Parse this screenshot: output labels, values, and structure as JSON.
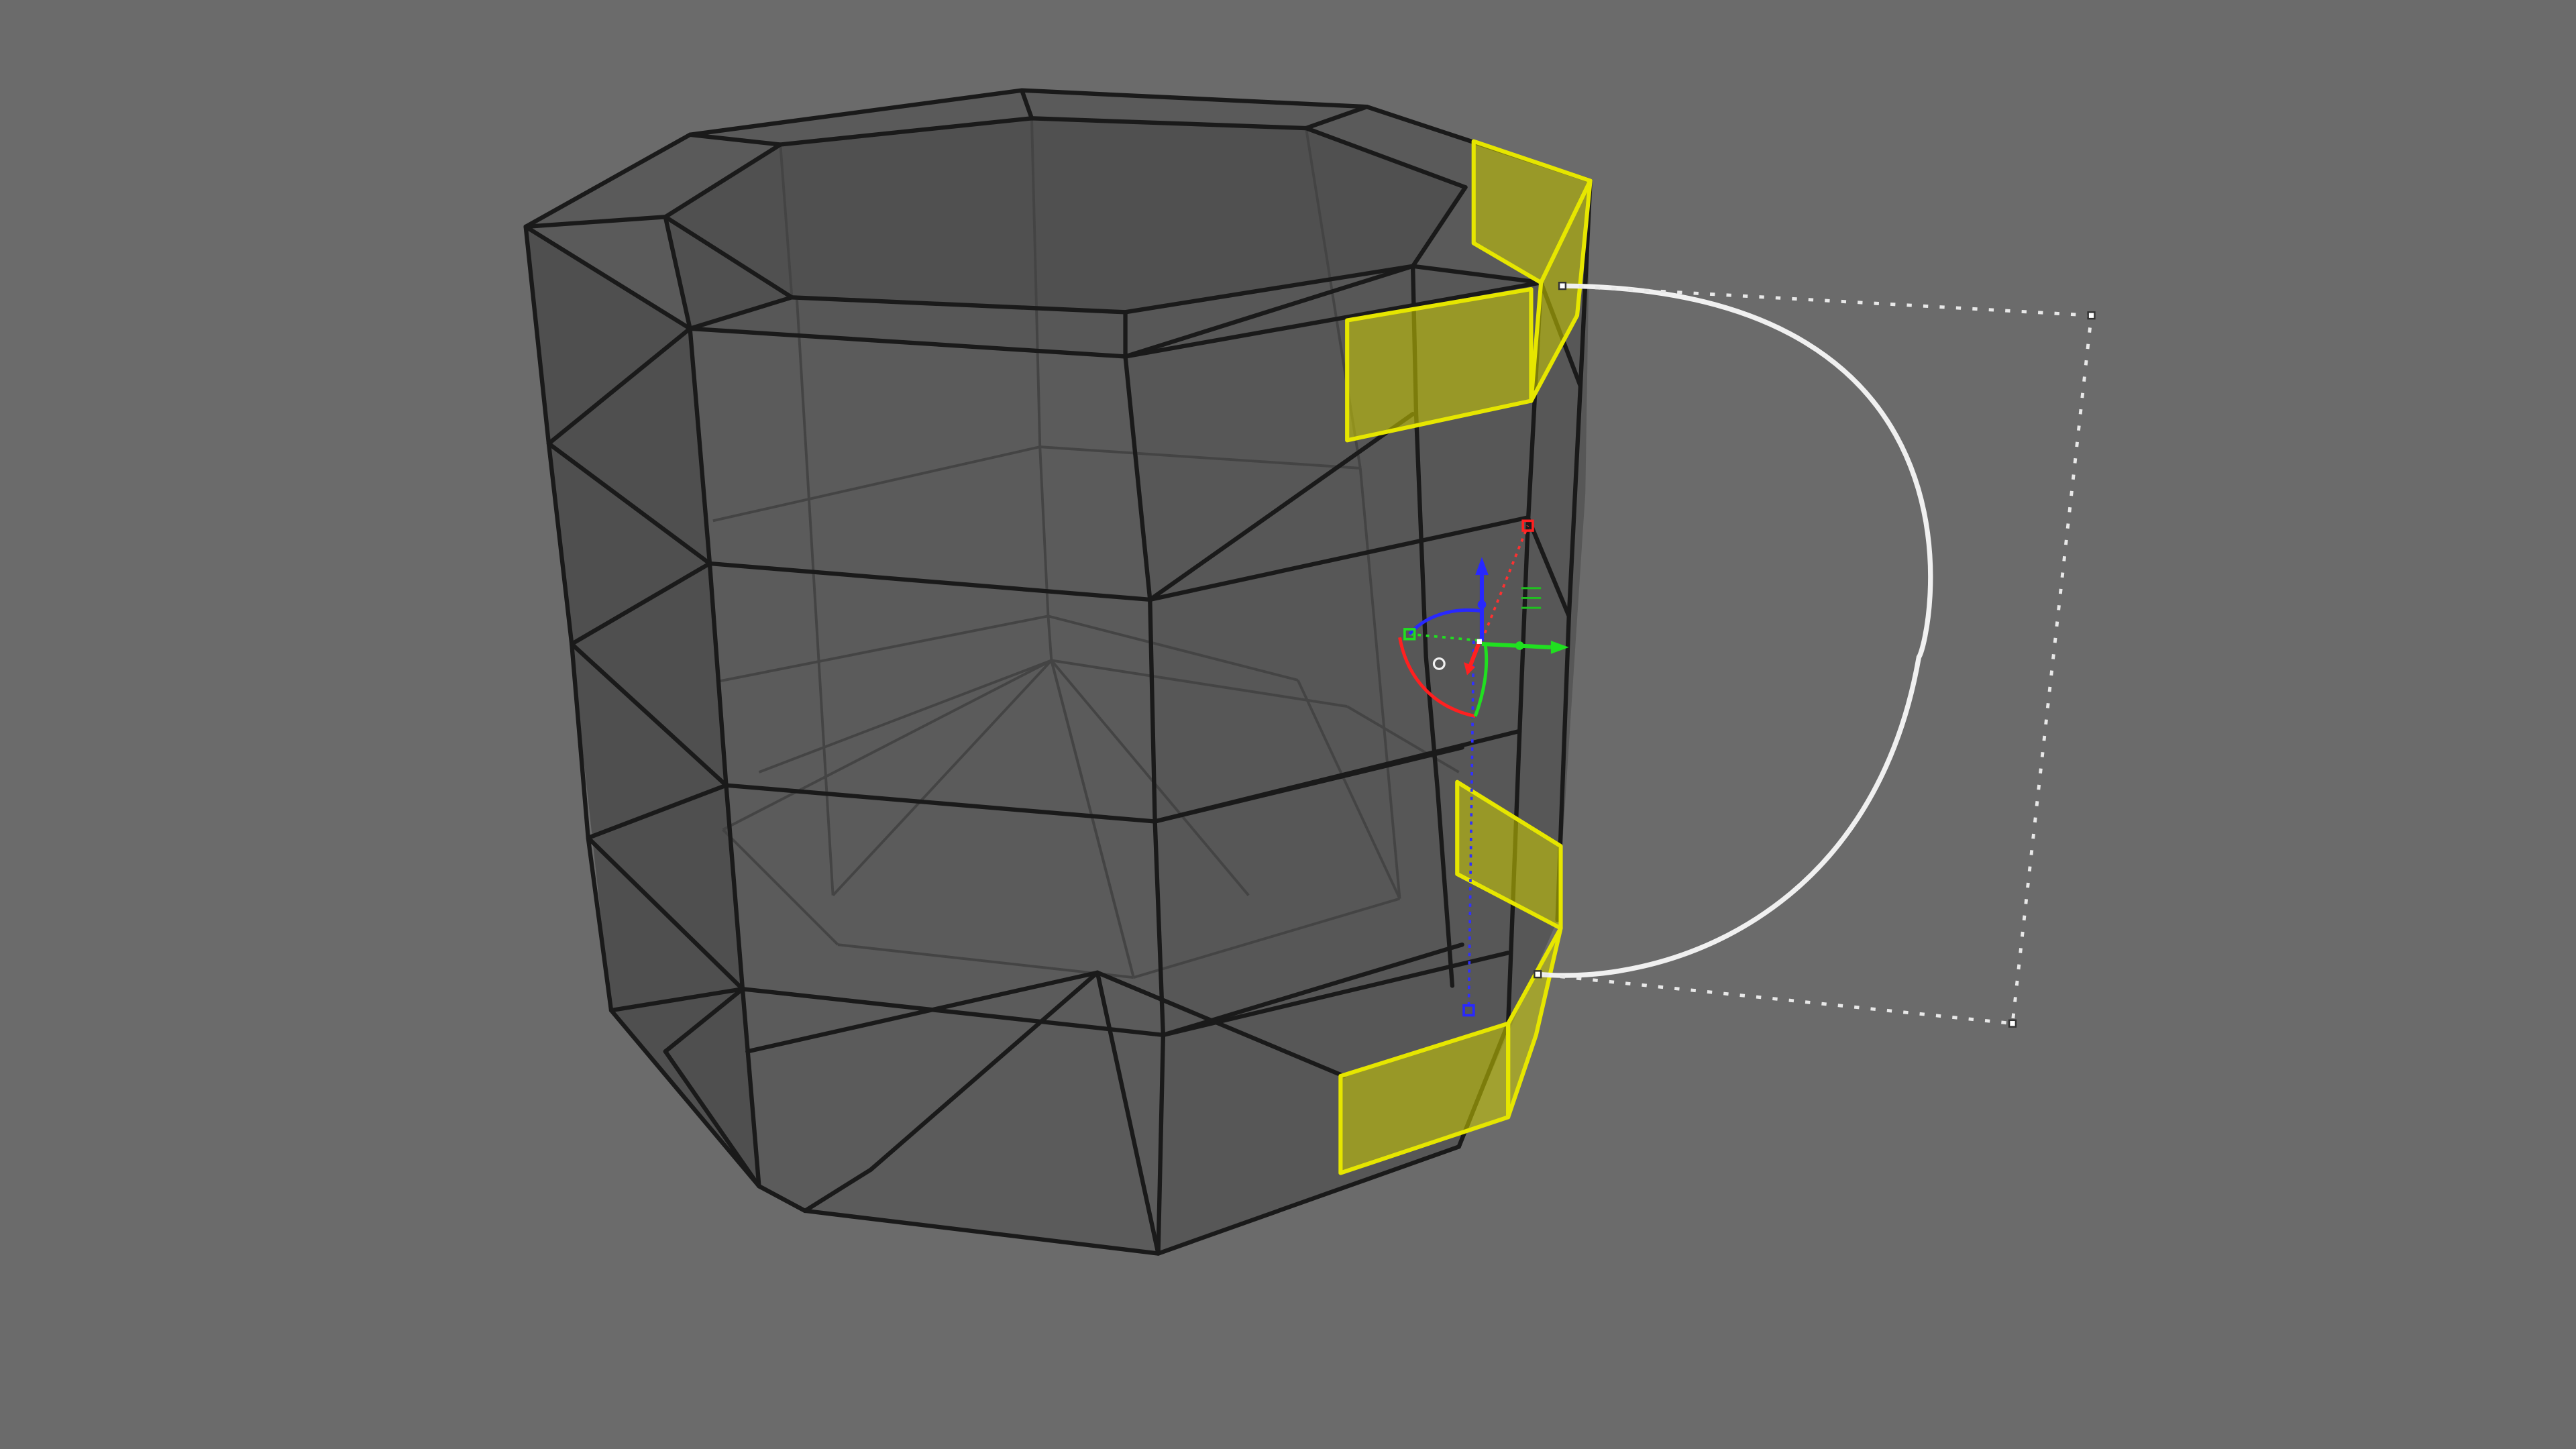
{
  "viewport": {
    "background": "#6b6b6b",
    "mesh_fill": "#555555",
    "edge_color": "#1a1a1a",
    "selection_color": "#e6e600"
  },
  "gizmo": {
    "x_axis_color": "#ff2020",
    "y_axis_color": "#20ff20",
    "z_axis_color": "#2020ff",
    "icons": [
      "move-arrow-z-icon",
      "move-arrow-y-icon",
      "rotate-ring-icon",
      "scale-handle-icon",
      "pivot-icon"
    ]
  },
  "curve": {
    "color": "#f0f0f0",
    "control_handle_color": "#ffffff"
  }
}
